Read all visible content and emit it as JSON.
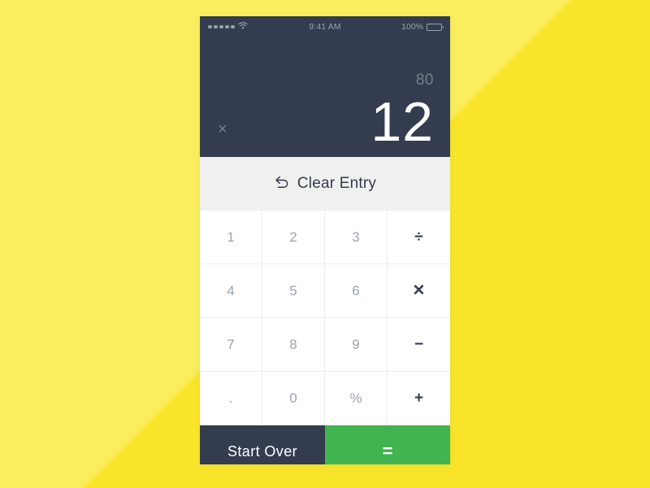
{
  "background": {
    "color_light": "#faee5f",
    "color_dark": "#f9e62b"
  },
  "status_bar": {
    "signal_dots": 5,
    "wifi_icon": "wifi-icon",
    "time": "9:41 AM",
    "battery_percent": "100%",
    "battery_icon": "battery-full-icon",
    "background_color": "#333d4f",
    "text_color": "#9aa1ad"
  },
  "display": {
    "previous_value": "80",
    "current_value": "12",
    "pending_operator": "×",
    "background_color": "#333d4f",
    "current_text_color": "#ffffff",
    "previous_text_color": "#77808e"
  },
  "clear_entry": {
    "label": "Clear Entry",
    "icon": "undo-arrow-icon",
    "background_color": "#f0f0ef",
    "text_color": "#333d4f"
  },
  "keypad": {
    "number_color": "#9aa4b4",
    "operator_color": "#333d4f",
    "keys": [
      {
        "label": "1",
        "type": "num",
        "name": "key-1"
      },
      {
        "label": "2",
        "type": "num",
        "name": "key-2"
      },
      {
        "label": "3",
        "type": "num",
        "name": "key-3"
      },
      {
        "label": "÷",
        "type": "op",
        "name": "key-divide"
      },
      {
        "label": "4",
        "type": "num",
        "name": "key-4"
      },
      {
        "label": "5",
        "type": "num",
        "name": "key-5"
      },
      {
        "label": "6",
        "type": "num",
        "name": "key-6"
      },
      {
        "label": "✕",
        "type": "op",
        "name": "key-multiply"
      },
      {
        "label": "7",
        "type": "num",
        "name": "key-7"
      },
      {
        "label": "8",
        "type": "num",
        "name": "key-8"
      },
      {
        "label": "9",
        "type": "num",
        "name": "key-9"
      },
      {
        "label": "−",
        "type": "op",
        "name": "key-minus"
      },
      {
        "label": ".",
        "type": "dot",
        "name": "key-decimal"
      },
      {
        "label": "0",
        "type": "num",
        "name": "key-0"
      },
      {
        "label": "%",
        "type": "num",
        "name": "key-percent"
      },
      {
        "label": "+",
        "type": "op",
        "name": "key-plus"
      }
    ]
  },
  "bottom_bar": {
    "start_over_label": "Start Over",
    "start_over_color": "#333d4f",
    "equals_label": "=",
    "equals_color": "#41b44f"
  }
}
